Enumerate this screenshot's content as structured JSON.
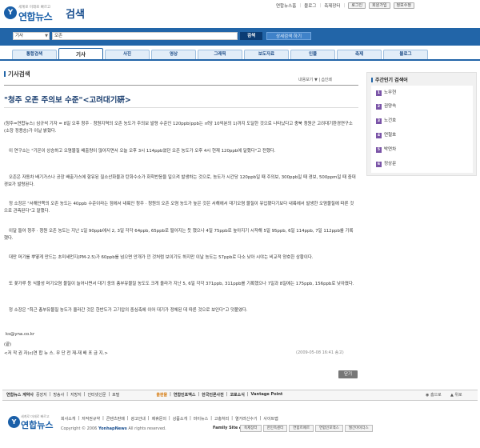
{
  "header": {
    "logo_tagline": "세계로 미래로 빠르고",
    "logo_name": "연합뉴스",
    "section_title": "검색",
    "top_links": [
      "연합뉴스홈",
      "블로그",
      "축제장터"
    ],
    "login": "로그인",
    "signup": "회원가입",
    "privacy": "정보수정"
  },
  "search": {
    "category": "기사",
    "query": "오존",
    "submit": "검색",
    "detail": "상세검색 하기"
  },
  "tabs": [
    "통합검색",
    "기사",
    "사진",
    "영상",
    "그래픽",
    "보도자료",
    "인물",
    "축제",
    "블로그"
  ],
  "active_tab": "기사",
  "content": {
    "heading": "기사검색",
    "tools": "내용보기 ▼ | ⎙인쇄",
    "article": {
      "title": "\"청주 오존 주의보 수준\"<고려대기硏>",
      "paragraphs": [
        "(청주=연합뉴스) 심규석 기자 = 8일 오후 청주 · 청원지역의 오존 농도가 주의보 발령 수준인 120ppb(ppb는 ㎥당 10억분의 1)까지 도달한 것으로 나타났다고 충북 청원군 고려대기환경연구소(소장 정용승)가 이날 밝혔다.",
        "이 연구소는 \"기온이 상승하고 오염물질 배출량이 많아지면서 오늘 오후 3시 114ppb였던 오존 농도가 오후 4시 현재 120ppb에 달했다\"고 전했다.",
        "오존은 자동차 배기가스나 공장 배출가스에 함유된 질소산화물과 탄화수소가 화학반응을 일으켜 발생하는 것으로, 농도가 시간당 120ppb일 때 주의보, 300ppb일 때 경보, 500ppm일 때 중대경보가 발령된다.",
        "정 소장은 \"서해안쪽의 오존 농도는 40ppb 수준이라는 점에서 내륙인 청주 · 청원의 오존 오염 농도가 높은 것은 서해에서 대기오염 물질이 유입됐다기보다 내륙에서 발생한 오염물질에 따른 것으로 관측된다\"고 말했다.",
        "이달 들어 청주 · 청원 오존 농도는 지난 1일 90ppb에서 2, 3일 각각 64ppb, 65ppb로 떨어지는 듯 했으나 4일 75ppb로 높아지기 시작해 5일 95ppb, 6일 114ppb, 7일 112ppb를 기록했다.",
        "대만 머기를 뿌옇게 만드는 초미세먼지(PM-2.5)가 60ppb를 넘으면 안개가 낀 것처럼 보이기도 하지만 이날 농도는 57ppb로 다소 낮아 시야는 비교적 양호한 상황이다.",
        "또 꽃가루 등 식물성 머기오염 물질이 늘어나면서 대기 중의 총부유물질 농도도 크게 올라가 지난 5, 6일 각각 371ppb, 311ppb를 기록했으나 7일과 8일에는 175ppb, 156ppb로 낮아졌다.",
        "정 소장은 \"최근 총부유물질 농도가 올라간 것은 한반도가 고기압의 중심축에 이어 대기가 정체된 데 따른 것으로 보인다\"고 덧붙였다."
      ],
      "email": "ks@yna.co.kr",
      "end_mark": "(끝)",
      "copyright": "<저 작 권 자(c)연 합 뉴 스. 무 단 전 재-재 배 포 금 지.>",
      "date": "(2009-05-08 16:41 송고)"
    },
    "close": "닫기"
  },
  "sidebar": {
    "title": "주간인기 검색어",
    "keywords": [
      "노무현",
      "권양숙",
      "노건호",
      "연철호",
      "박연차",
      "정상문"
    ]
  },
  "footer": {
    "title": "연합뉴스 계약사",
    "links": [
      "중앙지",
      "방송사",
      "지방지",
      "인터넷신문",
      "포털"
    ],
    "highlight_links": [
      "출판물",
      "연합인포맥스",
      "한국언론사전",
      "코로소식",
      "Vantage Point"
    ],
    "top_links": [
      "◉ 홈으로",
      "▲ 위로"
    ],
    "nav": [
      "회사소개",
      "저작권규약",
      "콘텐츠판매",
      "광고안내",
      "제휴문의",
      "상품소개",
      "마이뉴스",
      "고충처리",
      "열거려신수기",
      "사이트맵"
    ],
    "copyright_prefix": "Copyright © 2006",
    "copyright_brand": "YonhapNews",
    "copyright_suffix": "All rights reserved.",
    "family_label": "Family Site ▸",
    "family_sites": [
      "축제장터",
      "한민족센터",
      "연합르페르",
      "연합인포맥스",
      "월간마이더스"
    ]
  }
}
